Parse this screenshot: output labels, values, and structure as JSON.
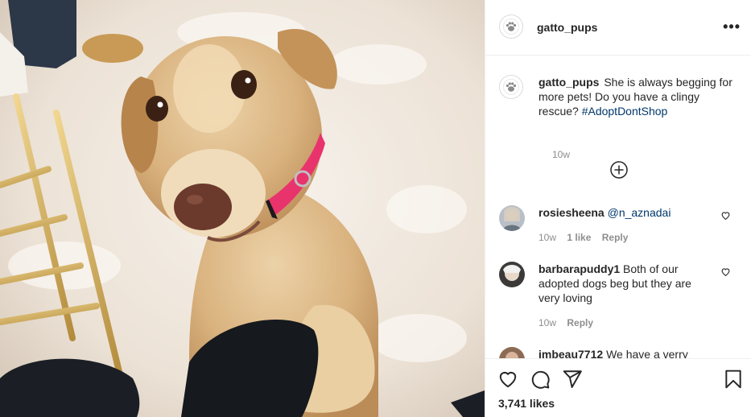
{
  "post": {
    "username": "gatto_pups",
    "more_label": "•••",
    "caption_text": "She is always begging for more pets! Do you have a clingy rescue?",
    "hashtag": "#AdoptDontShop",
    "caption_time": "10w",
    "likes": "3,741 likes"
  },
  "comments": [
    {
      "username": "rosiesheena",
      "text": "",
      "mention": "@n_aznadai",
      "time": "10w",
      "likes": "1 like",
      "reply": "Reply"
    },
    {
      "username": "barbarapuddy1",
      "text": "Both of our adopted dogs beg but they are very loving",
      "mention": "",
      "time": "10w",
      "likes": "",
      "reply": "Reply"
    },
    {
      "username": "jmbeau7712",
      "text": "We have a verry",
      "mention": "",
      "time": "",
      "likes": "",
      "reply": ""
    }
  ],
  "icons": {
    "avatar": "paw-icon",
    "load_more": "plus-circle-icon",
    "like": "heart-icon",
    "comment": "comment-icon",
    "share": "paper-plane-icon",
    "save": "bookmark-icon",
    "more": "more-options-icon"
  },
  "colors": {
    "link": "#00376b",
    "meta": "#8e8e8e",
    "text": "#262626",
    "collar": "#e8336d"
  }
}
